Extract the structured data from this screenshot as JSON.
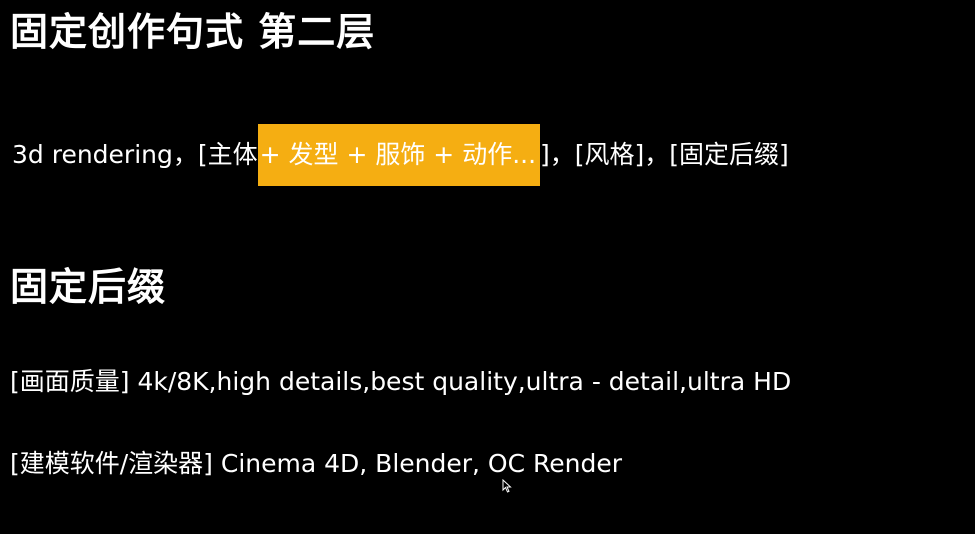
{
  "slide": {
    "title": "固定创作句式 第二层",
    "formula": {
      "prefix": "3d rendering，[主体",
      "highlight": " + 发型 + 服饰 + 动作...",
      "suffix": "]，[风格]，[固定后缀]"
    },
    "suffix_heading": "固定后缀",
    "lines": [
      "[画面质量] 4k/8K,high details,best quality,ultra - detail,ultra HD",
      "[建模软件/渲染器] Cinema 4D, Blender, OC Render"
    ]
  },
  "colors": {
    "background": "#000000",
    "text": "#ffffff",
    "highlight": "#F5AE12"
  },
  "icons": {
    "cursor": "mouse-pointer-icon"
  }
}
